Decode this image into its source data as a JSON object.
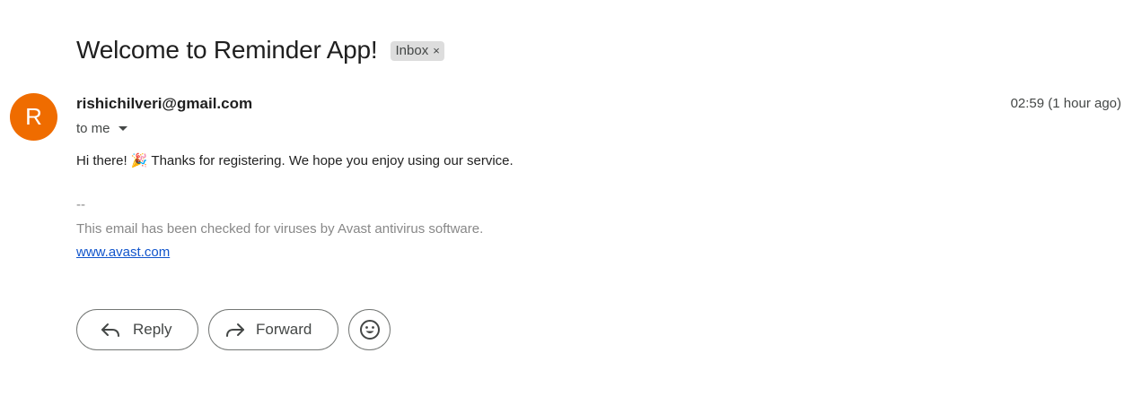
{
  "email": {
    "subject": "Welcome to Reminder App!",
    "label": "Inbox",
    "label_remove": "×",
    "sender_initial": "R",
    "sender": "rishichilveri@gmail.com",
    "timestamp": "02:59 (1 hour ago)",
    "recipient": "to me",
    "body": "Hi there! 🎉 Thanks for registering. We hope you enjoy using our service.",
    "signature_separator": "--",
    "signature_text": "This email has been checked for viruses by Avast antivirus software.",
    "signature_link": "www.avast.com"
  },
  "actions": {
    "reply_label": "Reply",
    "forward_label": "Forward"
  },
  "colors": {
    "avatar": "#ef6c00",
    "link": "#1155cc",
    "chip": "#dddddd"
  },
  "icons": [
    "reply-icon",
    "forward-icon",
    "emoji-icon",
    "chevron-down-icon",
    "close-icon"
  ]
}
